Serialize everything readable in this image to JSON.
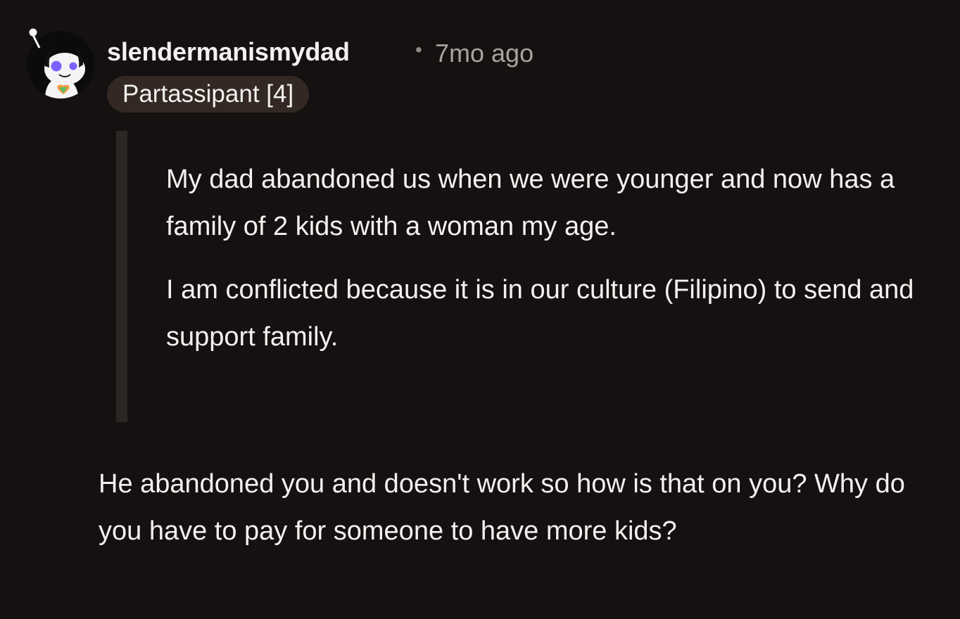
{
  "comment": {
    "author": "slendermanismydad",
    "separator": "•",
    "timestamp": "7mo ago",
    "flair": "Partassipant [4]",
    "avatar_icon": "snoo-avatar-icon",
    "quote": {
      "paragraphs": [
        "My dad abandoned us when we were younger and now has a family of 2 kids with a woman my age.",
        "I am conflicted because it is in our culture (Filipino) to send and support family."
      ]
    },
    "body": "He abandoned you and doesn't work so how is that on you? Why do you have to pay for someone to have more kids?"
  },
  "colors": {
    "background": "#141110",
    "text": "#f2f1ef",
    "meta": "#a9a39d",
    "flair_bg": "#332823",
    "quote_bar": "#2a2725"
  }
}
